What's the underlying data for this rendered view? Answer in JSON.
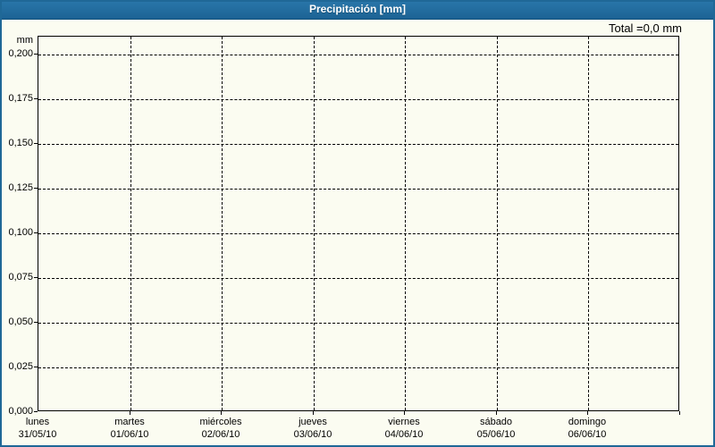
{
  "window": {
    "title": "Precipitación [mm]",
    "total_label": "Total =0,0 mm"
  },
  "colors": {
    "header_bg_top": "#2a77ab",
    "header_bg_bottom": "#1c6394",
    "frame_border": "#1f6897",
    "content_bg": "#fbfcf1",
    "grid": "#000000",
    "text": "#000000",
    "header_text": "#ffffff"
  },
  "chart_data": {
    "type": "bar",
    "title": "Precipitación [mm]",
    "ylabel": "mm",
    "total_annotation": "Total =0,0 mm",
    "categories": [
      "lunes",
      "martes",
      "miércoles",
      "jueves",
      "viernes",
      "sábado",
      "domingo"
    ],
    "dates": [
      "31/05/10",
      "01/06/10",
      "02/06/10",
      "03/06/10",
      "04/06/10",
      "05/06/10",
      "06/06/10"
    ],
    "series": [
      {
        "name": "Precipitación",
        "values": [
          0,
          0,
          0,
          0,
          0,
          0,
          0
        ]
      }
    ],
    "yticks": [
      "0,200",
      "0,175",
      "0,150",
      "0,125",
      "0,100",
      "0,075",
      "0,050",
      "0,025",
      "0,000"
    ],
    "ytick_values": [
      0.2,
      0.175,
      0.15,
      0.125,
      0.1,
      0.075,
      0.05,
      0.025,
      0.0
    ],
    "ylim": [
      0,
      0.21
    ],
    "grid": "dashed",
    "legend": "none"
  }
}
